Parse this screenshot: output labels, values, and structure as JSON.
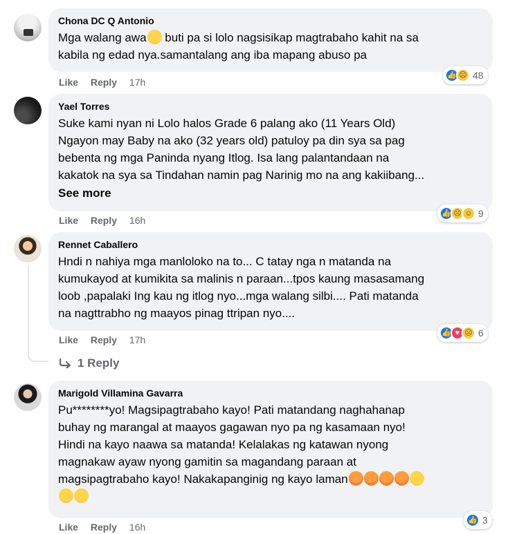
{
  "comments": [
    {
      "author": "Chona DC Q Antonio",
      "text_lines": [
        "Mga walang awa",
        " buti pa si lolo nagsisikap magtrabaho kahit na sa",
        "kabila ng edad nya.samantalang ang iba mapang abuso pa"
      ],
      "like": "Like",
      "reply": "Reply",
      "time": "17h",
      "reaction_count": "48"
    },
    {
      "author": "Yael Torres",
      "text_lines": [
        "Suke kami nyan ni Lolo halos Grade 6 palang ako (11 Years Old)",
        "Ngayon may Baby na ako (32 years old) patuloy pa din sya sa pag",
        "bebenta ng mga Paninda nyang Itlog. Isa lang palantandaan na",
        "kakatok na sya sa Tindahan namin pag Narinig mo na ang kakiibang..."
      ],
      "see_more": "See more",
      "like": "Like",
      "reply": "Reply",
      "time": "16h",
      "reaction_count": "9"
    },
    {
      "author": "Rennet Caballero",
      "text_lines": [
        "Hndi n nahiya mga manloloko na to... C tatay nga n matanda na",
        "kumukayod at kumikita sa malinis n paraan...tpos kaung masasamang",
        "loob ,papalaki Ing kau ng itlog nyo...mga walang silbi.... Pati matanda",
        "na nagttrabho ng maayos pinag ttripan nyo...."
      ],
      "like": "Like",
      "reply": "Reply",
      "time": "17h",
      "reaction_count": "6",
      "replies_label": "1 Reply"
    },
    {
      "author": "Marigold Villamina Gavarra",
      "text_lines": [
        "Pu********yo! Magsipagtrabaho kayo! Pati matandang naghahanap",
        "buhay ng marangal at maayos gagawan nyo pa ng kasamaan nyo!",
        "Hindi na kayo naawa sa matanda! Kelalakas ng katawan nyong",
        "magnakaw ayaw nyong gamitin sa magandang paraan at",
        "magsipagtrabaho kayo! Nakakapanginig ng kayo laman"
      ],
      "like": "Like",
      "reply": "Reply",
      "time": "16h",
      "reaction_count": "3"
    }
  ],
  "icons": [
    "like-reaction-icon",
    "sad-reaction-icon",
    "haha-reaction-icon",
    "love-reaction-icon",
    "reply-arrow-icon"
  ],
  "colors": {
    "bubble_bg": "#f0f2f5",
    "secondary_text": "#65676b",
    "like_blue": "#1877f2"
  }
}
